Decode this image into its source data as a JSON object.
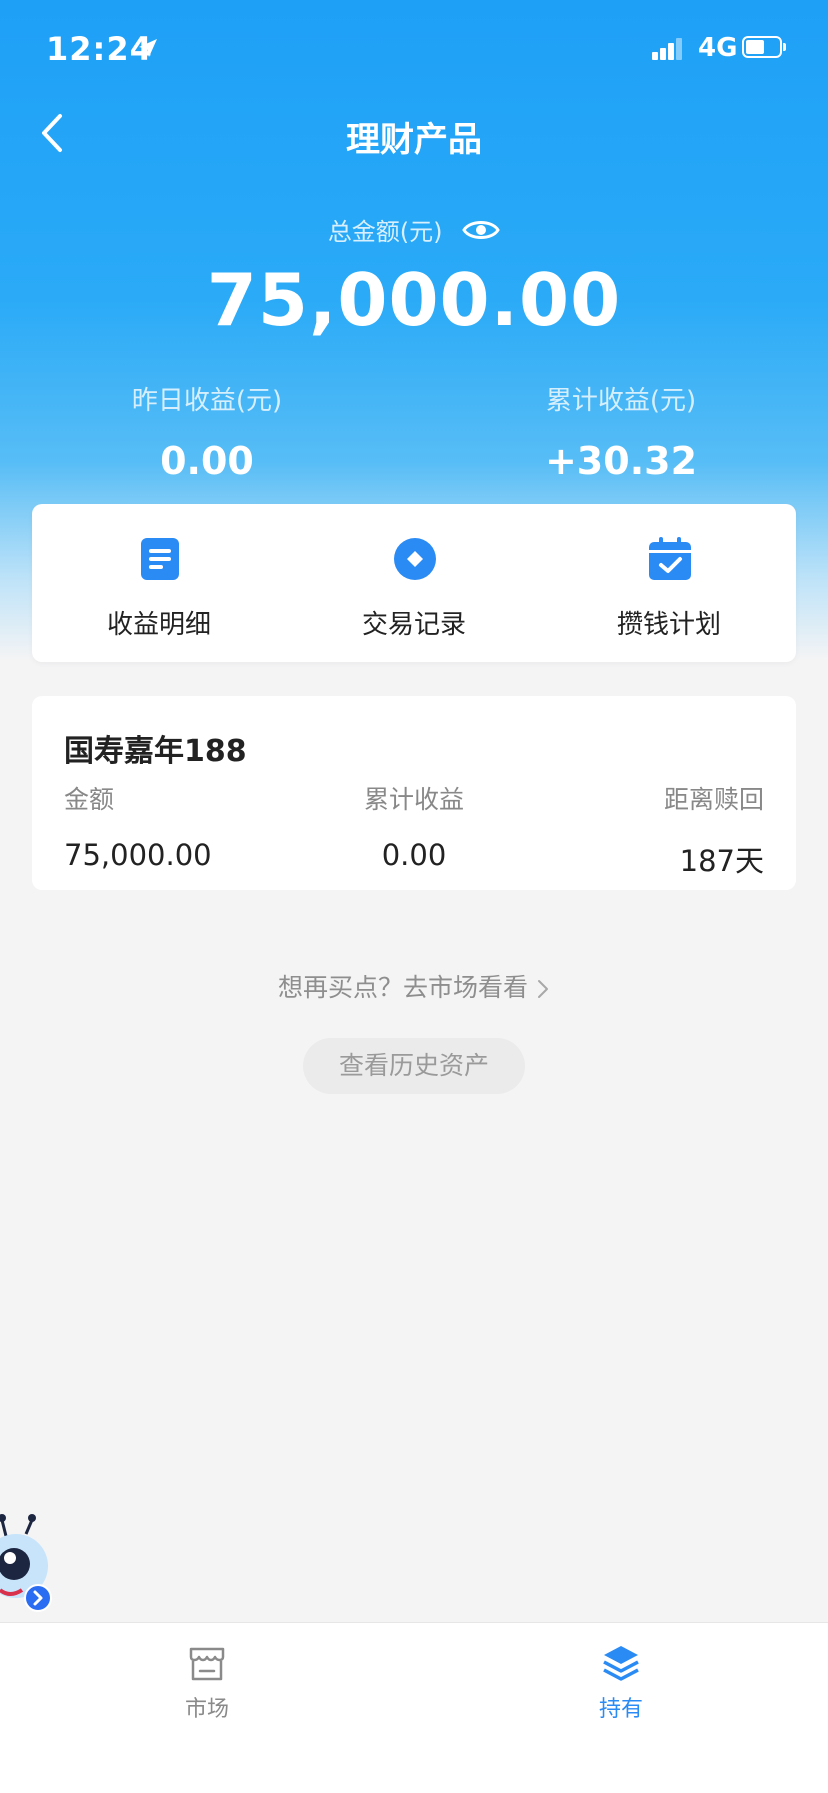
{
  "status_bar": {
    "time": "12:24",
    "network": "4G"
  },
  "nav": {
    "title": "理财产品"
  },
  "summary": {
    "total_label": "总金额(元)",
    "total_amount": "75,000.00",
    "yesterday_label": "昨日收益(元)",
    "yesterday_value": "0.00",
    "cumulative_label": "累计收益(元)",
    "cumulative_value": "+30.32"
  },
  "quick_actions": [
    {
      "label": "收益明细",
      "icon": "document-icon"
    },
    {
      "label": "交易记录",
      "icon": "coin-icon"
    },
    {
      "label": "攒钱计划",
      "icon": "calendar-check-icon"
    }
  ],
  "product": {
    "name": "国寿嘉年188",
    "amount_label": "金额",
    "amount_value": "75,000.00",
    "earnings_label": "累计收益",
    "earnings_value": "0.00",
    "redeem_label": "距离赎回",
    "redeem_value": "187天"
  },
  "market_link": "想再买点？去市场看看",
  "history_button": "查看历史资产",
  "tabs": [
    {
      "label": "市场",
      "icon": "store-icon",
      "active": false
    },
    {
      "label": "持有",
      "icon": "layers-icon",
      "active": true
    }
  ],
  "colors": {
    "primary": "#1ea0f7",
    "accent": "#2b8bf4",
    "background": "#f4f4f5"
  }
}
